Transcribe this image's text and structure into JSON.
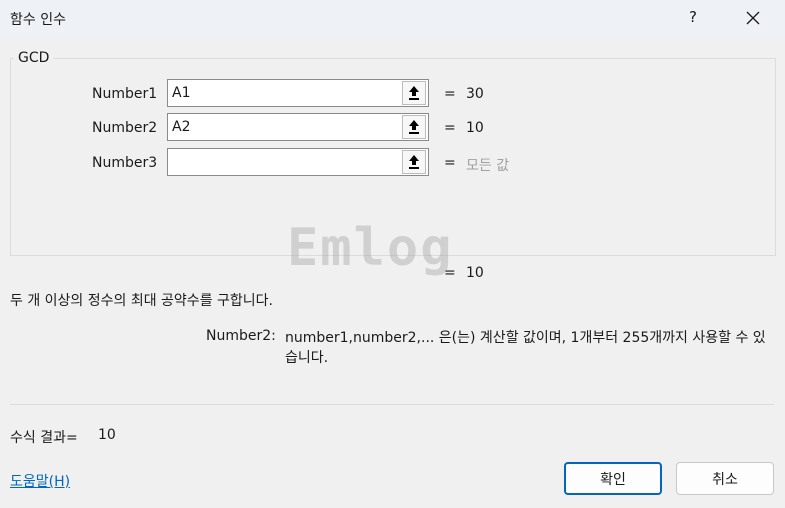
{
  "window": {
    "title": "함수 인수",
    "help_label": "?"
  },
  "function_name": "GCD",
  "arguments": [
    {
      "label": "Number1",
      "value": "A1",
      "result": "30"
    },
    {
      "label": "Number2",
      "value": "A2",
      "result": "10"
    },
    {
      "label": "Number3",
      "value": "",
      "result": "모든 값"
    }
  ],
  "equals_sign": "=",
  "watermark": "Emlog",
  "function_result": "10",
  "description": "두 개 이상의 정수의 최대 공약수를 구합니다.",
  "argument_help": {
    "name": "Number2:",
    "text": "number1,number2,... 은(는) 계산할 값이며, 1개부터 255개까지 사용할 수 있습니다."
  },
  "formula_result": {
    "label": "수식 결과=",
    "value": "10"
  },
  "help_link": "도움말(H)",
  "buttons": {
    "ok": "확인",
    "cancel": "취소"
  },
  "icons": {
    "close": "close-icon",
    "reference": "collapse-dialog-arrow-icon"
  }
}
